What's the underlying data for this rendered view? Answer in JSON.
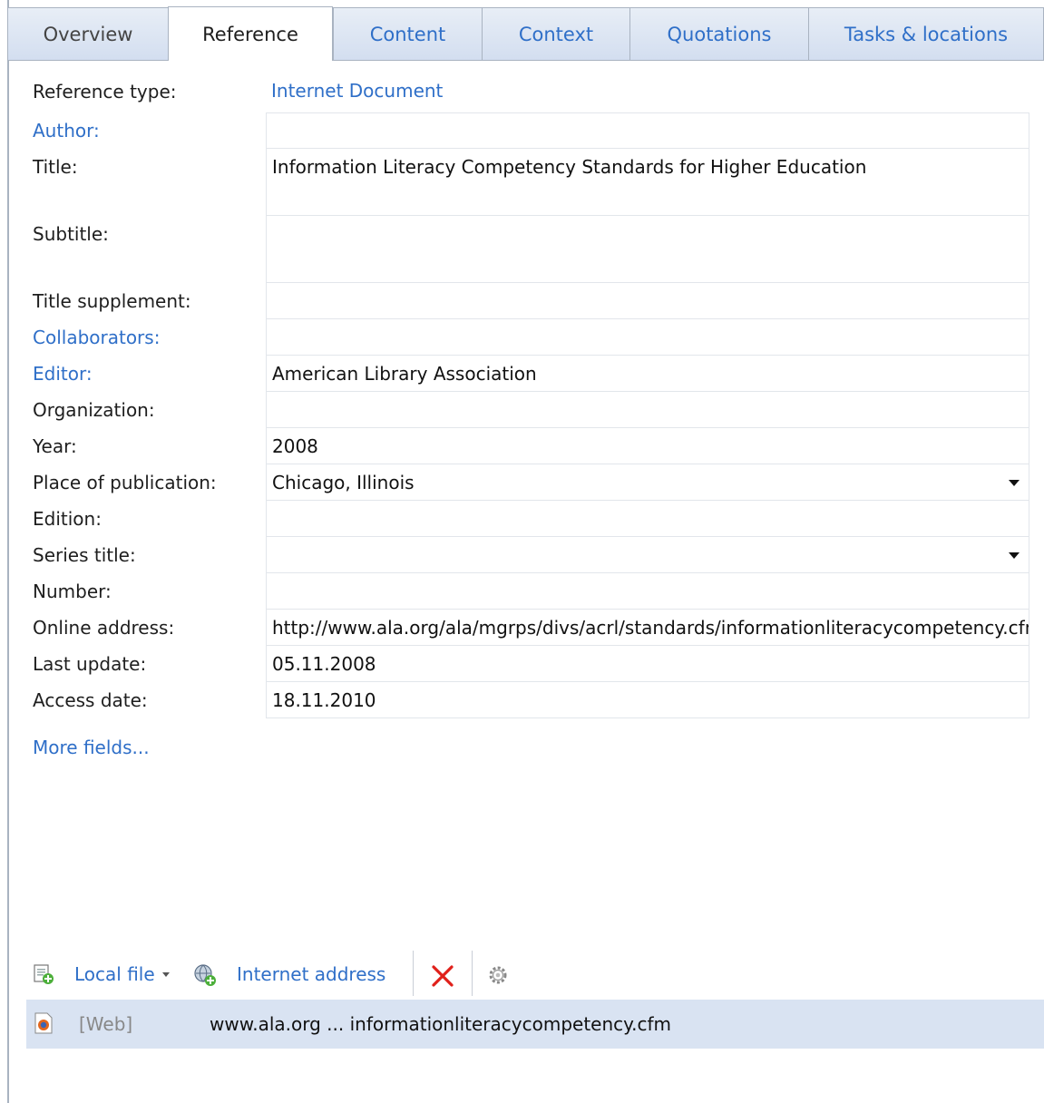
{
  "tabs": [
    "Overview",
    "Reference",
    "Content",
    "Context",
    "Quotations",
    "Tasks & locations"
  ],
  "reference_type": {
    "label": "Reference type:",
    "value": "Internet Document"
  },
  "fields": {
    "author": {
      "label": "Author:",
      "value": ""
    },
    "title": {
      "label": "Title:",
      "value": "Information Literacy Competency Standards for Higher Education"
    },
    "subtitle": {
      "label": "Subtitle:",
      "value": ""
    },
    "title_supp": {
      "label": "Title supplement:",
      "value": ""
    },
    "collaborators": {
      "label": "Collaborators:",
      "value": ""
    },
    "editor": {
      "label": "Editor:",
      "value": "American Library Association"
    },
    "organization": {
      "label": "Organization:",
      "value": ""
    },
    "year": {
      "label": "Year:",
      "value": "2008"
    },
    "place": {
      "label": "Place of publication:",
      "value": "Chicago, Illinois"
    },
    "edition": {
      "label": "Edition:",
      "value": ""
    },
    "series": {
      "label": "Series title:",
      "value": ""
    },
    "number": {
      "label": "Number:",
      "value": ""
    },
    "online": {
      "label": "Online address:",
      "value": "http://www.ala.org/ala/mgrps/divs/acrl/standards/informationliteracycompetency.cfm"
    },
    "last_update": {
      "label": "Last update:",
      "value": "05.11.2008"
    },
    "access_date": {
      "label": "Access date:",
      "value": "18.11.2010"
    }
  },
  "more_fields": "More fields...",
  "toolbar": {
    "local_file": "Local file",
    "internet_address": "Internet address"
  },
  "attachment": {
    "kind": "[Web]",
    "name": "www.ala.org ... informationliteracycompetency.cfm"
  },
  "colors": {
    "link": "#2f6fc8",
    "selected_row": "#d9e3f2",
    "delete": "#e0201a"
  }
}
